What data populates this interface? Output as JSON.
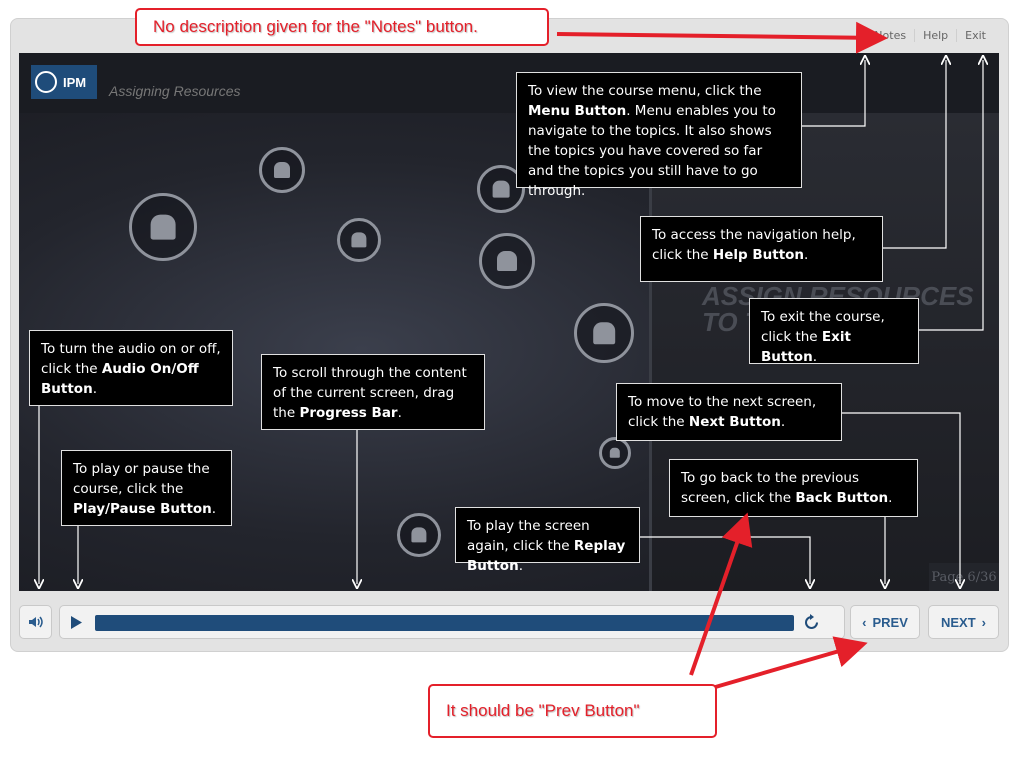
{
  "toplinks": {
    "notes": "Notes",
    "help": "Help",
    "exit": "Exit"
  },
  "course": {
    "logo_text": "IPM",
    "title": "Assigning Resources",
    "panel_heading_line1": "ASSIGN RESOURCES",
    "panel_heading_line2": "TO TASKS",
    "page_label": "Page 6/36"
  },
  "callouts": {
    "menu": {
      "t1": "To view the course menu, click the ",
      "b": "Menu Button",
      "t2": ". Menu enables you to navigate to the topics. It also shows the topics you have covered so far and the topics you still have to go through."
    },
    "help": {
      "t1": "To access the navigation help, click the ",
      "b": "Help Button",
      "t2": "."
    },
    "exit": {
      "t1": "To exit the course, click the ",
      "b": "Exit Button",
      "t2": "."
    },
    "audio": {
      "t1": "To turn the audio on or off, click the ",
      "b": "Audio On/Off Button",
      "t2": "."
    },
    "progress": {
      "t1": "To scroll through the content of the current screen, drag the ",
      "b": "Progress Bar",
      "t2": "."
    },
    "next": {
      "t1": "To move to the next screen, click the ",
      "b": "Next Button",
      "t2": "."
    },
    "play": {
      "t1": "To play or pause the course, click the ",
      "b": "Play/Pause Button",
      "t2": "."
    },
    "back": {
      "t1": "To go back to the previous screen, click the ",
      "b": "Back Button",
      "t2": "."
    },
    "replay": {
      "t1": "To play the screen again, click the ",
      "b": "Replay Button",
      "t2": "."
    }
  },
  "controls": {
    "prev": "PREV",
    "next": "NEXT",
    "progress_fraction": 1.0
  },
  "annotations": {
    "notes_issue": "No description given for the \"Notes\" button.",
    "prev_issue": "It should be \"Prev Button\""
  },
  "colors": {
    "accent": "#1f4c7a",
    "annotation_red": "#e4202a"
  },
  "icons": {
    "audio": "speaker-icon",
    "play": "play-icon",
    "replay": "replay-icon",
    "prev": "chevron-left-icon",
    "next": "chevron-right-icon"
  }
}
